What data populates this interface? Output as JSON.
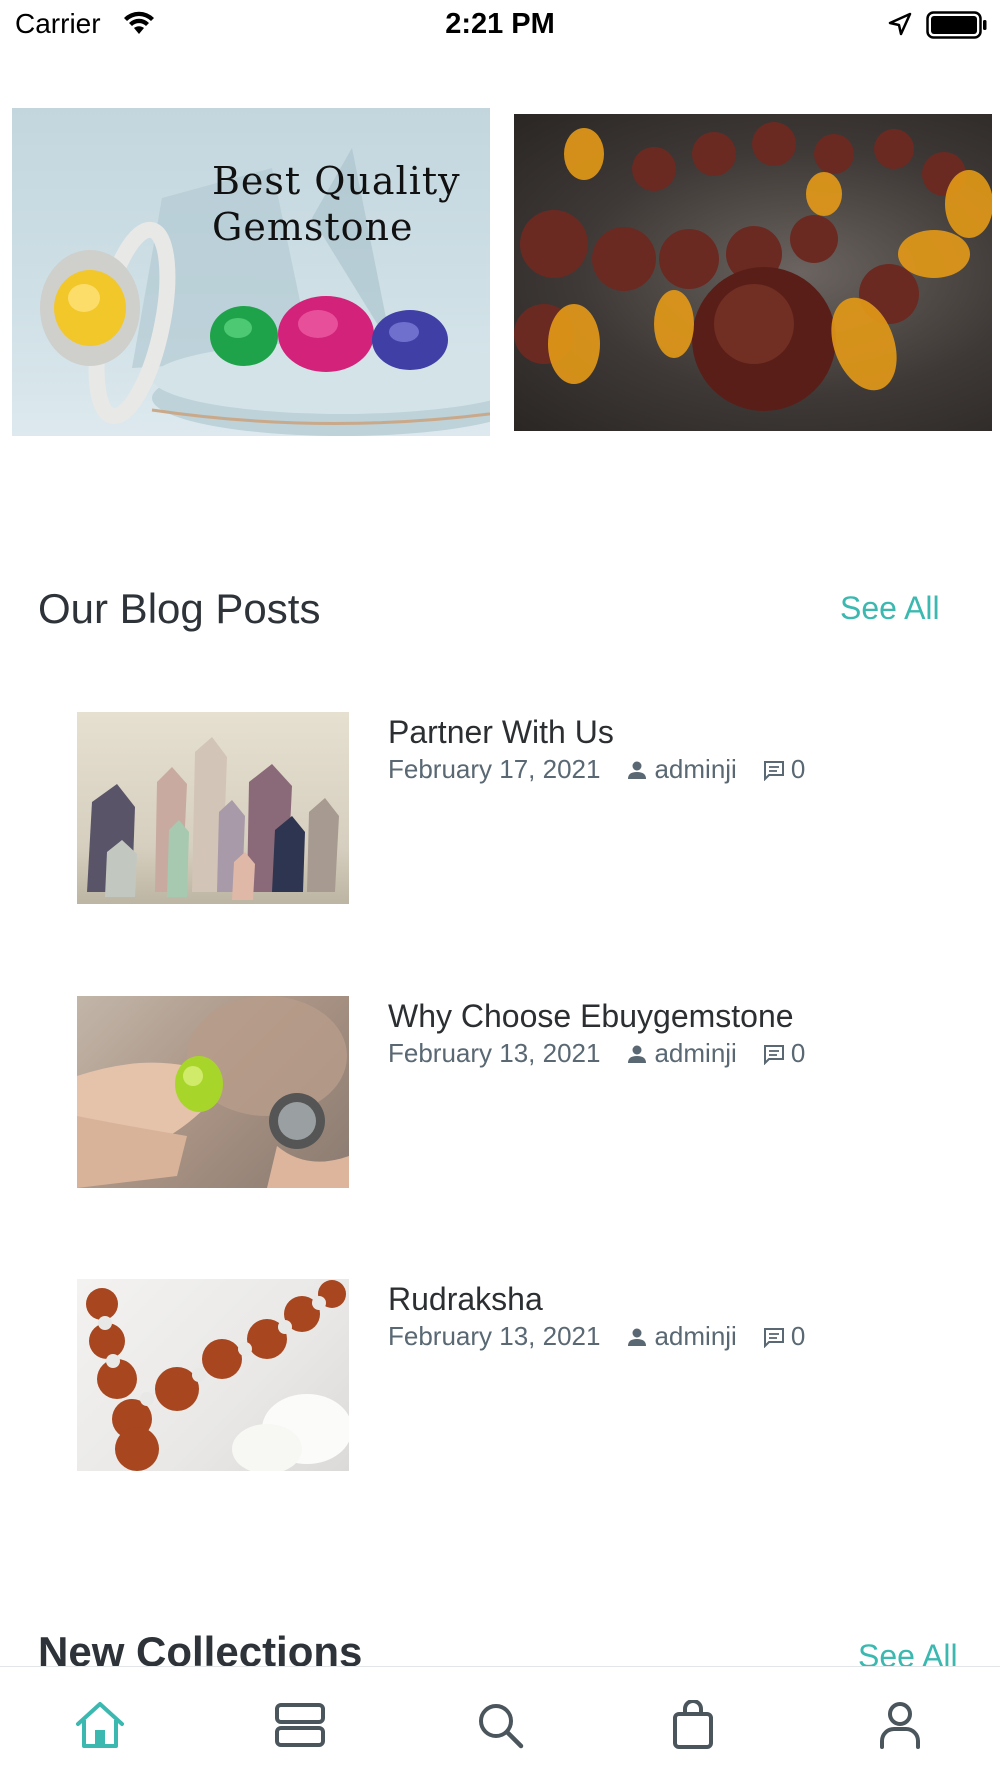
{
  "status_bar": {
    "carrier": "Carrier",
    "time": "2:21 PM"
  },
  "banners": [
    {
      "title_line1": "Best Quality",
      "title_line2": "Gemstone"
    },
    {
      "image": "rudraksha-amber-beads"
    }
  ],
  "blog_section": {
    "title": "Our Blog Posts",
    "see_all": "See All",
    "posts": [
      {
        "title": "Partner With Us",
        "date": "February 17, 2021",
        "author": "adminji",
        "comments": "0"
      },
      {
        "title": "Why Choose Ebuygemstone",
        "date": "February 13, 2021",
        "author": "adminji",
        "comments": "0"
      },
      {
        "title": "Rudraksha",
        "date": "February 13, 2021",
        "author": "adminji",
        "comments": "0"
      }
    ]
  },
  "collections_section": {
    "title": "New Collections",
    "see_all": "See All"
  },
  "tab_bar": {
    "accent": "#3bb9b0",
    "inactive": "#4a555c",
    "items": [
      "home-icon",
      "categories-icon",
      "search-icon",
      "cart-icon",
      "account-icon"
    ],
    "active_index": 0
  }
}
